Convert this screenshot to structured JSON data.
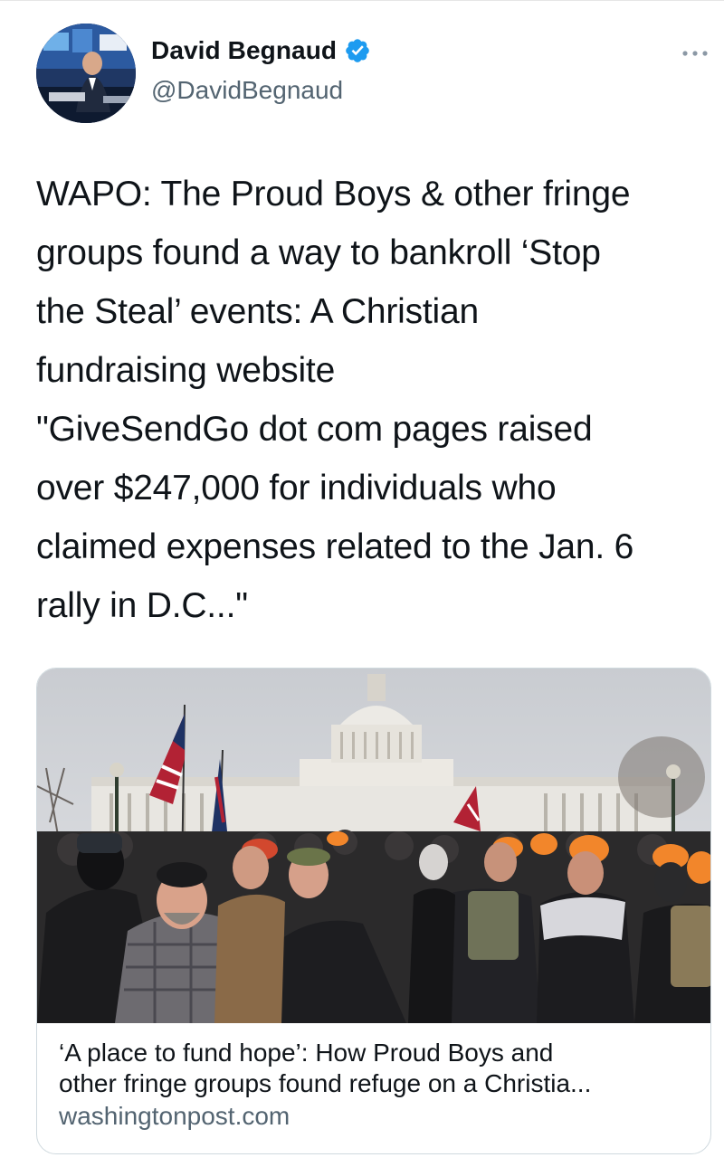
{
  "tweet": {
    "author": {
      "display_name": "David Begnaud",
      "handle": "@DavidBegnaud",
      "verified": true,
      "avatar_icon": "profile-photo"
    },
    "more_icon": "more-horizontal-icon",
    "text": "WAPO: The Proud Boys & other fringe\ngroups found a way to bankroll ‘Stop\nthe Steal’ events: A Christian\nfundraising website\n\"GiveSendGo dot com pages raised\nover $247,000 for individuals who\nclaimed expenses related to the Jan. 6\nrally in D.C...\"",
    "card": {
      "image_icon": "capitol-crowd-photo",
      "title": "‘A place to fund hope’: How Proud Boys and\nother fringe groups found refuge on a Christia...",
      "domain": "washingtonpost.com"
    }
  },
  "colors": {
    "verified_blue": "#1d9bf0",
    "secondary_text": "#536471",
    "border": "#cfd9de"
  }
}
